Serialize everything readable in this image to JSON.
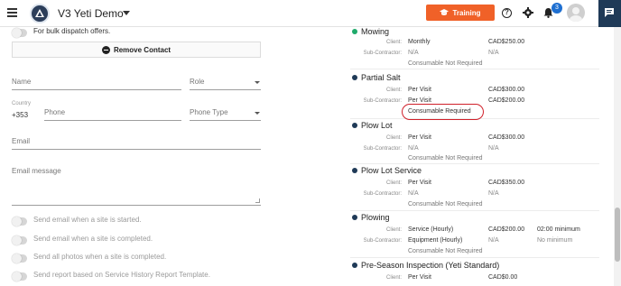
{
  "header": {
    "app_title": "V3 Yeti Demo",
    "training_label": "Training",
    "notification_count": "3",
    "help_symbol": "?"
  },
  "form": {
    "bulk_dispatch_label": "For bulk dispatch offers.",
    "remove_contact_label": "Remove Contact",
    "name_placeholder": "Name",
    "role_placeholder": "Role",
    "country_label": "Country",
    "country_code": "+353",
    "phone_placeholder": "Phone",
    "phone_type_placeholder": "Phone Type",
    "email_placeholder": "Email",
    "email_message_placeholder": "Email message",
    "toggles": [
      {
        "label": "Send email when a site is started."
      },
      {
        "label": "Send email when a site is completed."
      },
      {
        "label": "Send all photos when a site is completed."
      },
      {
        "label": "Send report based on Service History Report Template."
      }
    ]
  },
  "services": [
    {
      "name": "Mowing",
      "dot_color": "#1faa6b",
      "client_label": "Client:",
      "client_value": "Monthly",
      "client_price": "CAD$250.00",
      "sub_label": "Sub-Contractor:",
      "sub_value": "N/A",
      "sub_price": "N/A",
      "consumable": "Consumable Not Required"
    },
    {
      "name": "Partial Salt",
      "dot_color": "#1f3a57",
      "client_label": "Client:",
      "client_value": "Per Visit",
      "client_price": "CAD$300.00",
      "sub_label": "Sub-Contractor:",
      "sub_value": "Per Visit",
      "sub_price": "CAD$200.00",
      "consumable": "Consumable Required"
    },
    {
      "name": "Plow Lot",
      "dot_color": "#1f3a57",
      "client_label": "Client:",
      "client_value": "Per Visit",
      "client_price": "CAD$300.00",
      "sub_label": "Sub-Contractor:",
      "sub_value": "N/A",
      "sub_price": "N/A",
      "consumable": "Consumable Not Required"
    },
    {
      "name": "Plow Lot Service",
      "dot_color": "#1f3a57",
      "client_label": "Client:",
      "client_value": "Per Visit",
      "client_price": "CAD$350.00",
      "sub_label": "Sub-Contractor:",
      "sub_value": "N/A",
      "sub_price": "N/A",
      "consumable": "Consumable Not Required"
    },
    {
      "name": "Plowing",
      "dot_color": "#1f3a57",
      "client_label": "Client:",
      "client_value": "Service (Hourly)",
      "client_price": "CAD$200.00",
      "client_extra": "02:00 minimum",
      "sub_label": "Sub-Contractor:",
      "sub_value": "Equipment (Hourly)",
      "sub_price": "N/A",
      "sub_extra": "No minimum",
      "consumable": "Consumable Not Required"
    },
    {
      "name": "Pre-Season Inspection (Yeti Standard)",
      "dot_color": "#1f3a57",
      "client_label": "Client:",
      "client_value": "Per Visit",
      "client_price": "CAD$0.00"
    }
  ],
  "colors": {
    "training_bg": "#f06128",
    "badge_bg": "#1e6fd1",
    "highlight": "#d0202a"
  }
}
